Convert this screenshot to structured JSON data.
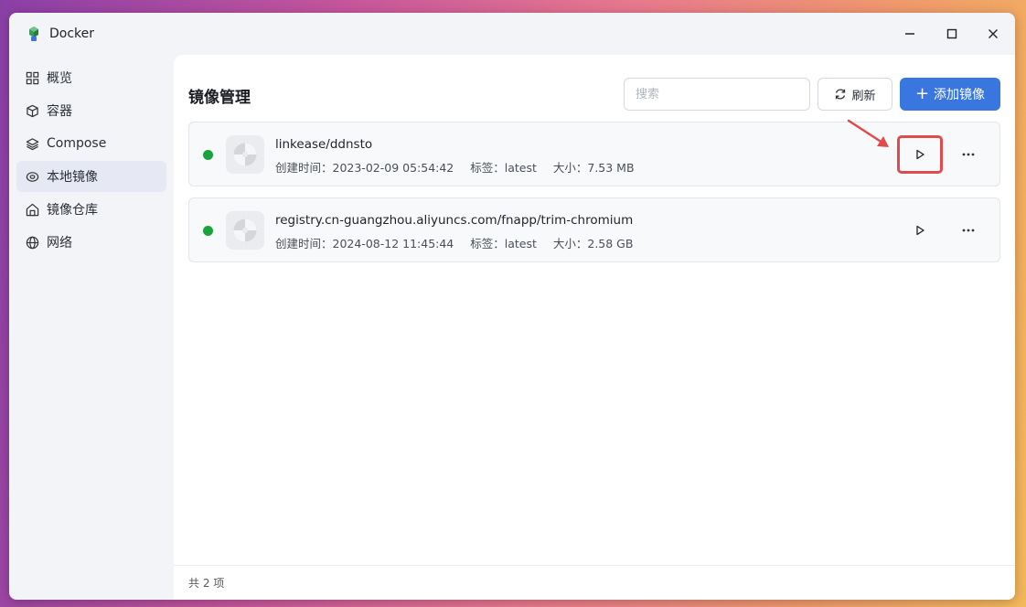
{
  "window": {
    "title": "Docker"
  },
  "sidebar": {
    "items": [
      {
        "label": "概览",
        "icon": "grid-icon"
      },
      {
        "label": "容器",
        "icon": "cube-icon"
      },
      {
        "label": "Compose",
        "icon": "layers-icon"
      },
      {
        "label": "本地镜像",
        "icon": "disk-icon",
        "active": true
      },
      {
        "label": "镜像仓库",
        "icon": "warehouse-icon"
      },
      {
        "label": "网络",
        "icon": "globe-icon"
      }
    ]
  },
  "main": {
    "title": "镜像管理",
    "search_placeholder": "搜索",
    "refresh_label": "刷新",
    "add_label": "添加镜像",
    "images": [
      {
        "name": "linkease/ddnsto",
        "created": "创建时间：2023-02-09 05:54:42",
        "tag": "标签：latest",
        "size": "大小：7.53 MB",
        "status_color": "#1aa33a"
      },
      {
        "name": "registry.cn-guangzhou.aliyuncs.com/fnapp/trim-chromium",
        "created": "创建时间：2024-08-12 11:45:44",
        "tag": "标签：latest",
        "size": "大小：2.58 GB",
        "status_color": "#1aa33a"
      }
    ],
    "footer": "共 2 项"
  },
  "colors": {
    "accent": "#3a76e0",
    "highlight": "#e14a4a",
    "running": "#1aa33a"
  }
}
